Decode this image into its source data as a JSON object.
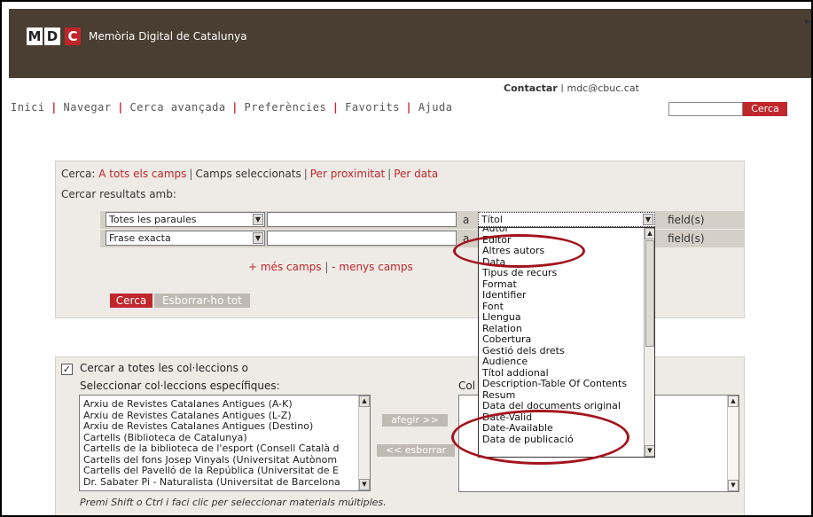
{
  "header": {
    "logo_letters": [
      "M",
      "D",
      "C"
    ],
    "site_title": "Memòria Digital de Catalunya",
    "contact": "Contactar",
    "email": "mdc@cbuc.cat",
    "bg_color": "#4a3d31"
  },
  "nav": {
    "items": [
      "Inici",
      "Navegar",
      "Cerca avançada",
      "Preferències",
      "Favorits",
      "Ajuda"
    ],
    "search_button": "Cerca",
    "search_value": ""
  },
  "search": {
    "cerca_label": "Cerca:",
    "modes": [
      "A tots els camps",
      "Camps seleccionats",
      "Per proximitat",
      "Per data"
    ],
    "active_mode": "Camps seleccionats",
    "results_label": "Cercar resultats amb:",
    "rows": [
      {
        "match": "Totes les paraules",
        "term": "",
        "a": "a",
        "field": "Títol",
        "suffix": "field(s)"
      },
      {
        "match": "Frase exacta",
        "term": "",
        "a": "a",
        "field": "",
        "suffix": "field(s)"
      }
    ],
    "more_fields": "+ més camps",
    "less_fields": "- menys camps",
    "search_button": "Cerca",
    "clear_button": "Esborrar-ho tot"
  },
  "field_dropdown": {
    "options": [
      "Autor",
      "Editor",
      "Altres autors",
      "Data",
      "Tipus de recurs",
      "Format",
      "Identifier",
      "Font",
      "Llengua",
      "Relation",
      "Cobertura",
      "Gestió dels drets",
      "Audience",
      "Títol addional",
      "Description-Table Of Contents",
      "Resum",
      "Data del documents original",
      "Date-Valid",
      "Date-Available",
      "Data de publicació"
    ]
  },
  "collections": {
    "all_checked": true,
    "all_label": "Cercar a totes les col·leccions o",
    "select_label": "Seleccionar col·leccions específiques:",
    "selected_label": "Col",
    "items": [
      "Arxiu de Revistes Catalanes Antigues (A-K)",
      "Arxiu de Revistes Catalanes Antigues (L-Z)",
      "Arxiu de Revistes Catalanes Antigues (Destino)",
      "Cartells (Biblioteca de Catalunya)",
      "Cartells de la biblioteca de l'esport (Consell Català d",
      "Cartells del fons Josep Vinyals (Universitat Autònom",
      "Cartells del Pavelló de la República (Universitat de E",
      "Dr. Sabater Pi - Naturalista (Universitat de Barcelona"
    ],
    "add_button": "afegir >>",
    "remove_button": "<< esborrar",
    "hint": "Premi Shift o Ctrl i faci clic per seleccionar materials múltiples."
  },
  "colors": {
    "accent": "#c0262b",
    "panel": "#eeebe7",
    "annotation": "#a3131c"
  }
}
